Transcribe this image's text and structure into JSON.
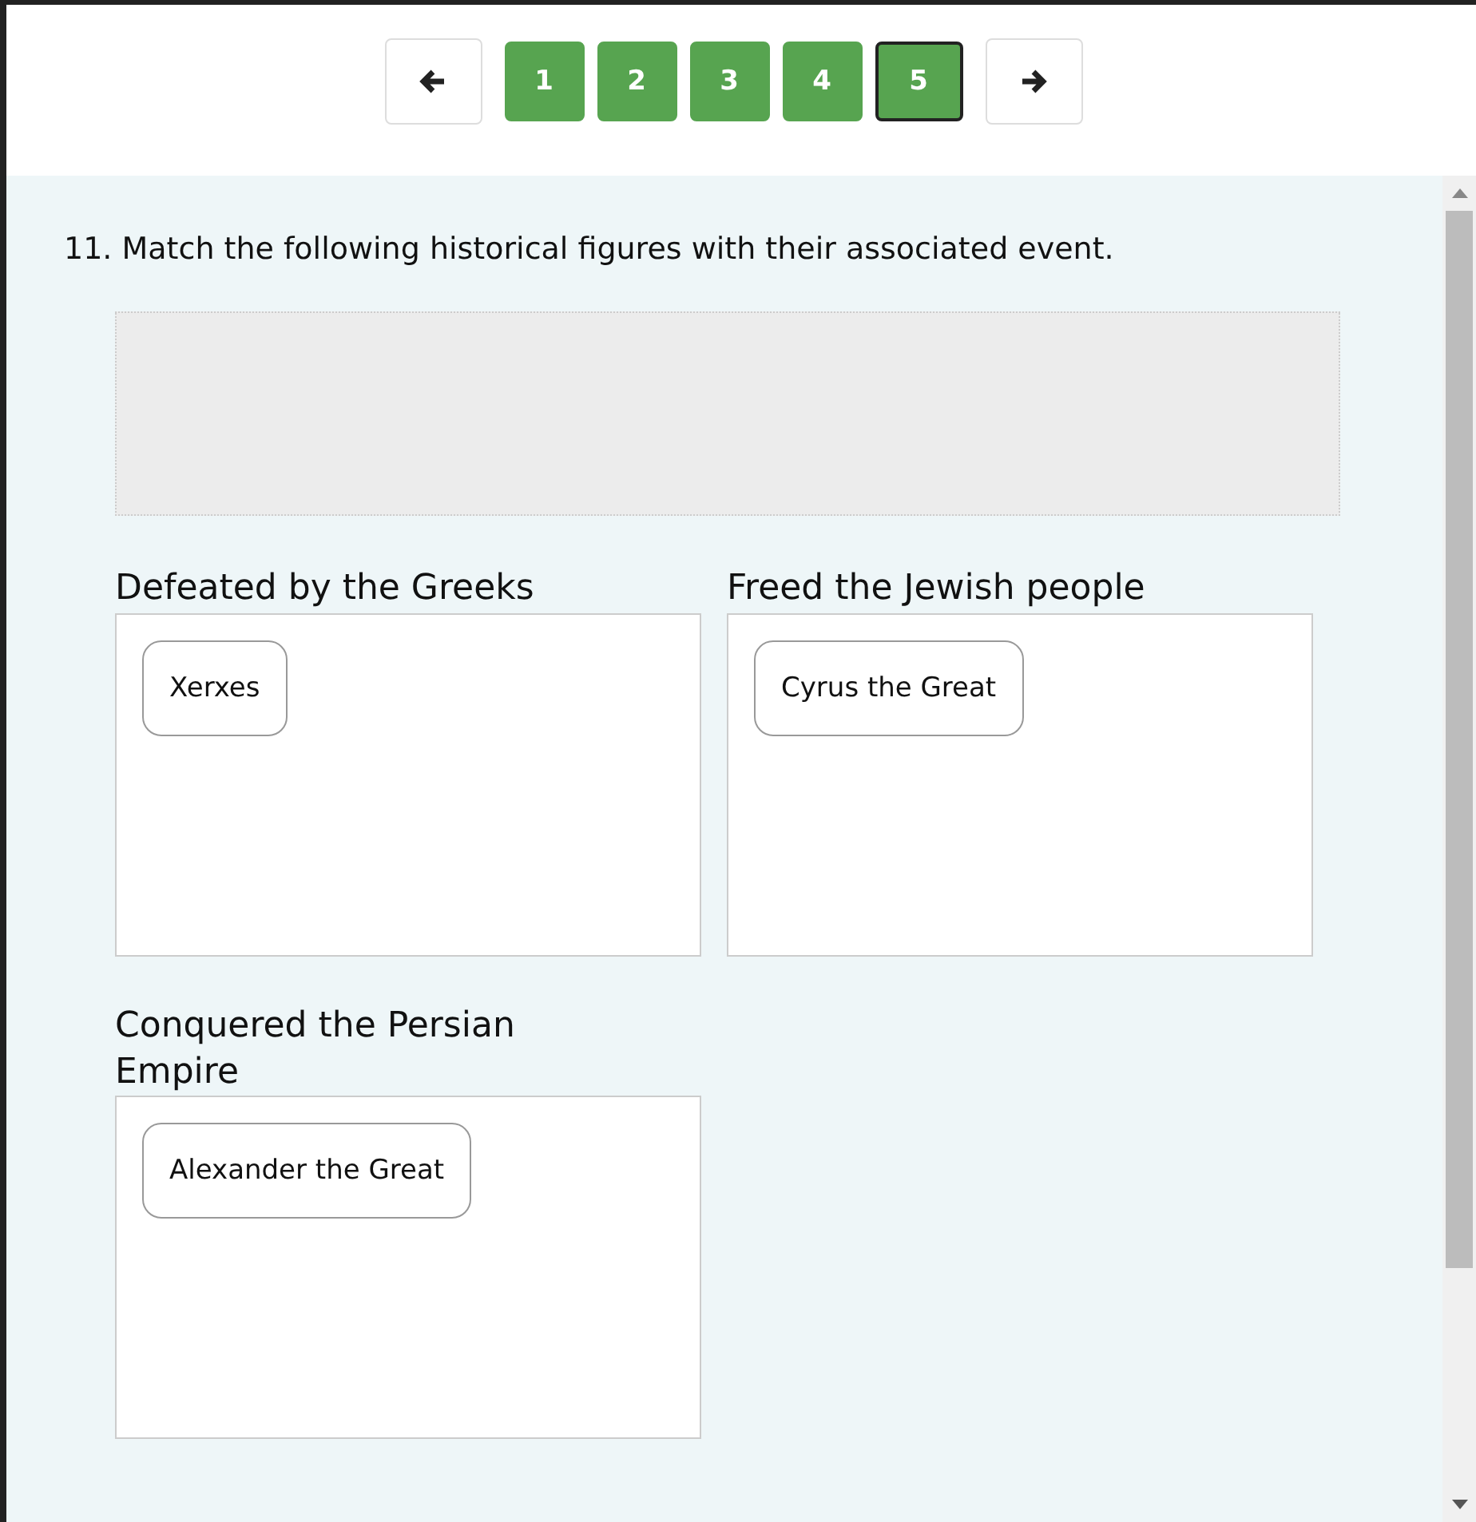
{
  "pagination": {
    "pages": [
      {
        "label": "1",
        "selected": false
      },
      {
        "label": "2",
        "selected": false
      },
      {
        "label": "3",
        "selected": false
      },
      {
        "label": "4",
        "selected": false
      },
      {
        "label": "5",
        "selected": true
      }
    ]
  },
  "question": {
    "text": "11. Match the following historical figures with their associated event.",
    "zones": [
      {
        "title": "Defeated by the Greeks",
        "items": [
          "Xerxes"
        ]
      },
      {
        "title": "Freed the Jewish people",
        "items": [
          "Cyrus the Great"
        ]
      },
      {
        "title": "Conquered the Persian Empire",
        "items": [
          "Alexander the Great"
        ]
      }
    ]
  }
}
